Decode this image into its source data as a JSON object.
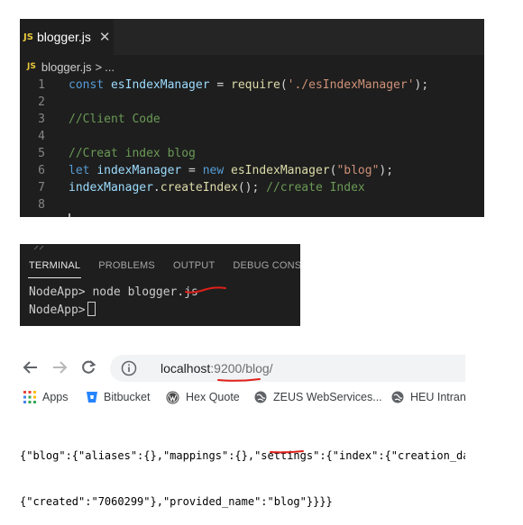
{
  "editor": {
    "tab": {
      "icon": "JS",
      "label": "blogger.js",
      "close": "✕"
    },
    "breadcrumb": {
      "icon": "JS",
      "file": "blogger.js",
      "separator": ">",
      "more": "..."
    },
    "lines": [
      {
        "n": "1",
        "parts": [
          {
            "t": "const",
            "c": "kw"
          },
          {
            "t": " ",
            "c": "pl"
          },
          {
            "t": "esIndexManager",
            "c": "vr"
          },
          {
            "t": " = ",
            "c": "pl"
          },
          {
            "t": "require",
            "c": "fn"
          },
          {
            "t": "(",
            "c": "pl"
          },
          {
            "t": "'./esIndexManager'",
            "c": "st"
          },
          {
            "t": ");",
            "c": "pl"
          }
        ]
      },
      {
        "n": "2",
        "parts": []
      },
      {
        "n": "3",
        "parts": [
          {
            "t": "//Client Code",
            "c": "cm"
          }
        ]
      },
      {
        "n": "4",
        "parts": []
      },
      {
        "n": "5",
        "parts": [
          {
            "t": "//Creat index blog",
            "c": "cm"
          }
        ]
      },
      {
        "n": "6",
        "parts": [
          {
            "t": "let",
            "c": "kw"
          },
          {
            "t": " ",
            "c": "pl"
          },
          {
            "t": "indexManager",
            "c": "vr"
          },
          {
            "t": " = ",
            "c": "pl"
          },
          {
            "t": "new",
            "c": "kw"
          },
          {
            "t": " ",
            "c": "pl"
          },
          {
            "t": "esIndexManager",
            "c": "fn"
          },
          {
            "t": "(",
            "c": "pl"
          },
          {
            "t": "\"blog\"",
            "c": "st"
          },
          {
            "t": ");",
            "c": "pl"
          }
        ]
      },
      {
        "n": "7",
        "parts": [
          {
            "t": "indexManager",
            "c": "vr"
          },
          {
            "t": ".",
            "c": "pl"
          },
          {
            "t": "createIndex",
            "c": "fn"
          },
          {
            "t": "(); ",
            "c": "pl"
          },
          {
            "t": "//create Index",
            "c": "cm"
          }
        ]
      },
      {
        "n": "8",
        "parts": []
      }
    ]
  },
  "terminal": {
    "tabs": [
      "TERMINAL",
      "PROBLEMS",
      "OUTPUT",
      "DEBUG CONSOLE"
    ],
    "active_tab": "TERMINAL",
    "line1": {
      "prompt": "NodeApp>",
      "command": " node blogger.js"
    },
    "line2": {
      "prompt": "NodeApp>"
    }
  },
  "browser": {
    "url_host": "localhost",
    "url_path": ":9200/blog/",
    "bookmarks": [
      {
        "label": "Apps",
        "icon": "apps-grid-icon"
      },
      {
        "label": "Bitbucket",
        "icon": "bitbucket-icon"
      },
      {
        "label": "Hex Quote",
        "icon": "wordpress-icon"
      },
      {
        "label": "ZEUS WebServices...",
        "icon": "globe-icon"
      },
      {
        "label": "HEU Intran",
        "icon": "globe-icon"
      }
    ],
    "response": [
      "{\"blog\":{\"aliases\":{},\"mappings\":{},\"settings\":{\"index\":{\"creation_dat",
      "{\"created\":\"7060299\"},\"provided_name\":\"blog\"}}}}"
    ]
  },
  "colors": {
    "annotation_red": "#e0201a",
    "vscode_bg": "#1e1e1e",
    "js_yellow": "#e8c93a"
  }
}
